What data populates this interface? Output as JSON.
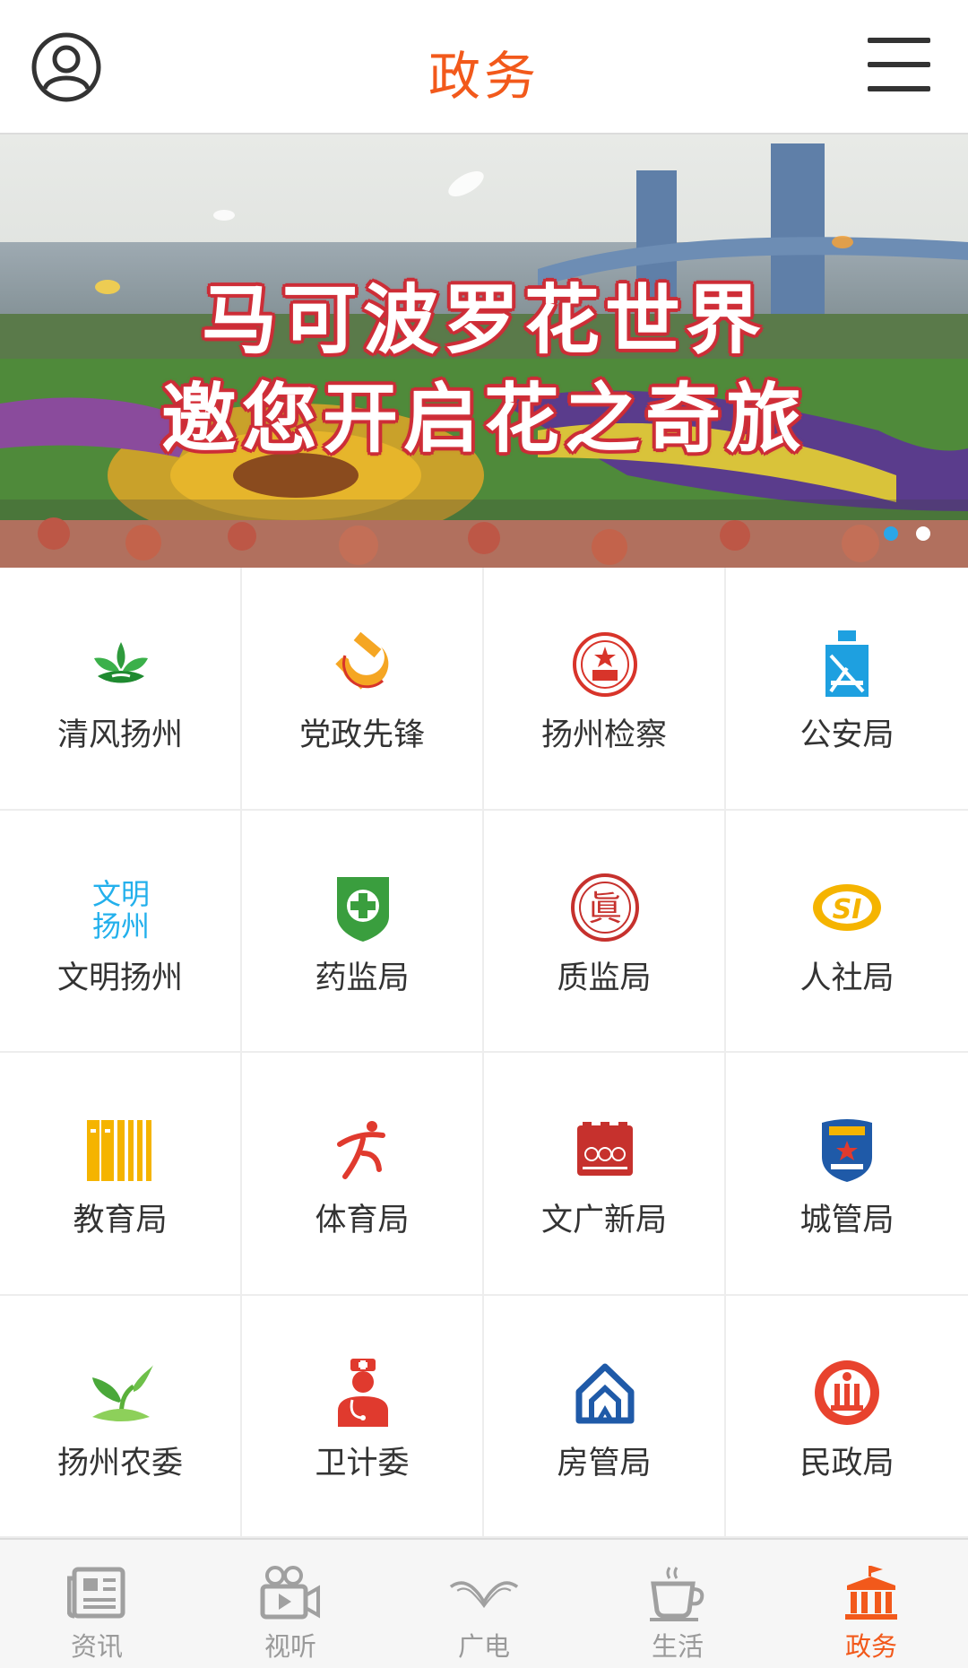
{
  "header": {
    "title": "政务",
    "avatar_icon": "user-profile-icon",
    "menu_icon": "hamburger-menu-icon",
    "title_color": "#f2591b"
  },
  "banner": {
    "caption_line1": "马可波罗花世界",
    "caption_line2": "邀您开启花之奇旅",
    "slide_count": 2,
    "active_slide": 1
  },
  "grid": {
    "items": [
      {
        "label": "清风扬州",
        "icon": "green-lotus-icon"
      },
      {
        "label": "党政先锋",
        "icon": "hammer-sickle-icon"
      },
      {
        "label": "扬州检察",
        "icon": "procuratorate-emblem-icon"
      },
      {
        "label": "公安局",
        "icon": "police-icon"
      },
      {
        "label": "文明扬州",
        "icon": "civilized-yangzhou-text-icon",
        "icon_text": "文明扬州"
      },
      {
        "label": "药监局",
        "icon": "drug-admin-shield-icon"
      },
      {
        "label": "质监局",
        "icon": "quality-seal-icon"
      },
      {
        "label": "人社局",
        "icon": "social-security-logo-icon"
      },
      {
        "label": "教育局",
        "icon": "books-icon"
      },
      {
        "label": "体育局",
        "icon": "sports-runner-icon"
      },
      {
        "label": "文广新局",
        "icon": "culture-broadcast-icon"
      },
      {
        "label": "城管局",
        "icon": "urban-management-badge-icon"
      },
      {
        "label": "扬州农委",
        "icon": "leaf-sprout-icon"
      },
      {
        "label": "卫计委",
        "icon": "doctor-icon"
      },
      {
        "label": "房管局",
        "icon": "house-icon"
      },
      {
        "label": "民政局",
        "icon": "civil-affairs-emblem-icon"
      }
    ]
  },
  "tabbar": {
    "tabs": [
      {
        "label": "资讯",
        "icon": "newspaper-icon",
        "active": false
      },
      {
        "label": "视听",
        "icon": "video-camera-icon",
        "active": false
      },
      {
        "label": "广电",
        "icon": "broadcast-logo-icon",
        "active": false
      },
      {
        "label": "生活",
        "icon": "coffee-cup-icon",
        "active": false
      },
      {
        "label": "政务",
        "icon": "government-building-icon",
        "active": true
      }
    ],
    "active_color": "#f2591b",
    "inactive_color": "#9a9a9a"
  }
}
